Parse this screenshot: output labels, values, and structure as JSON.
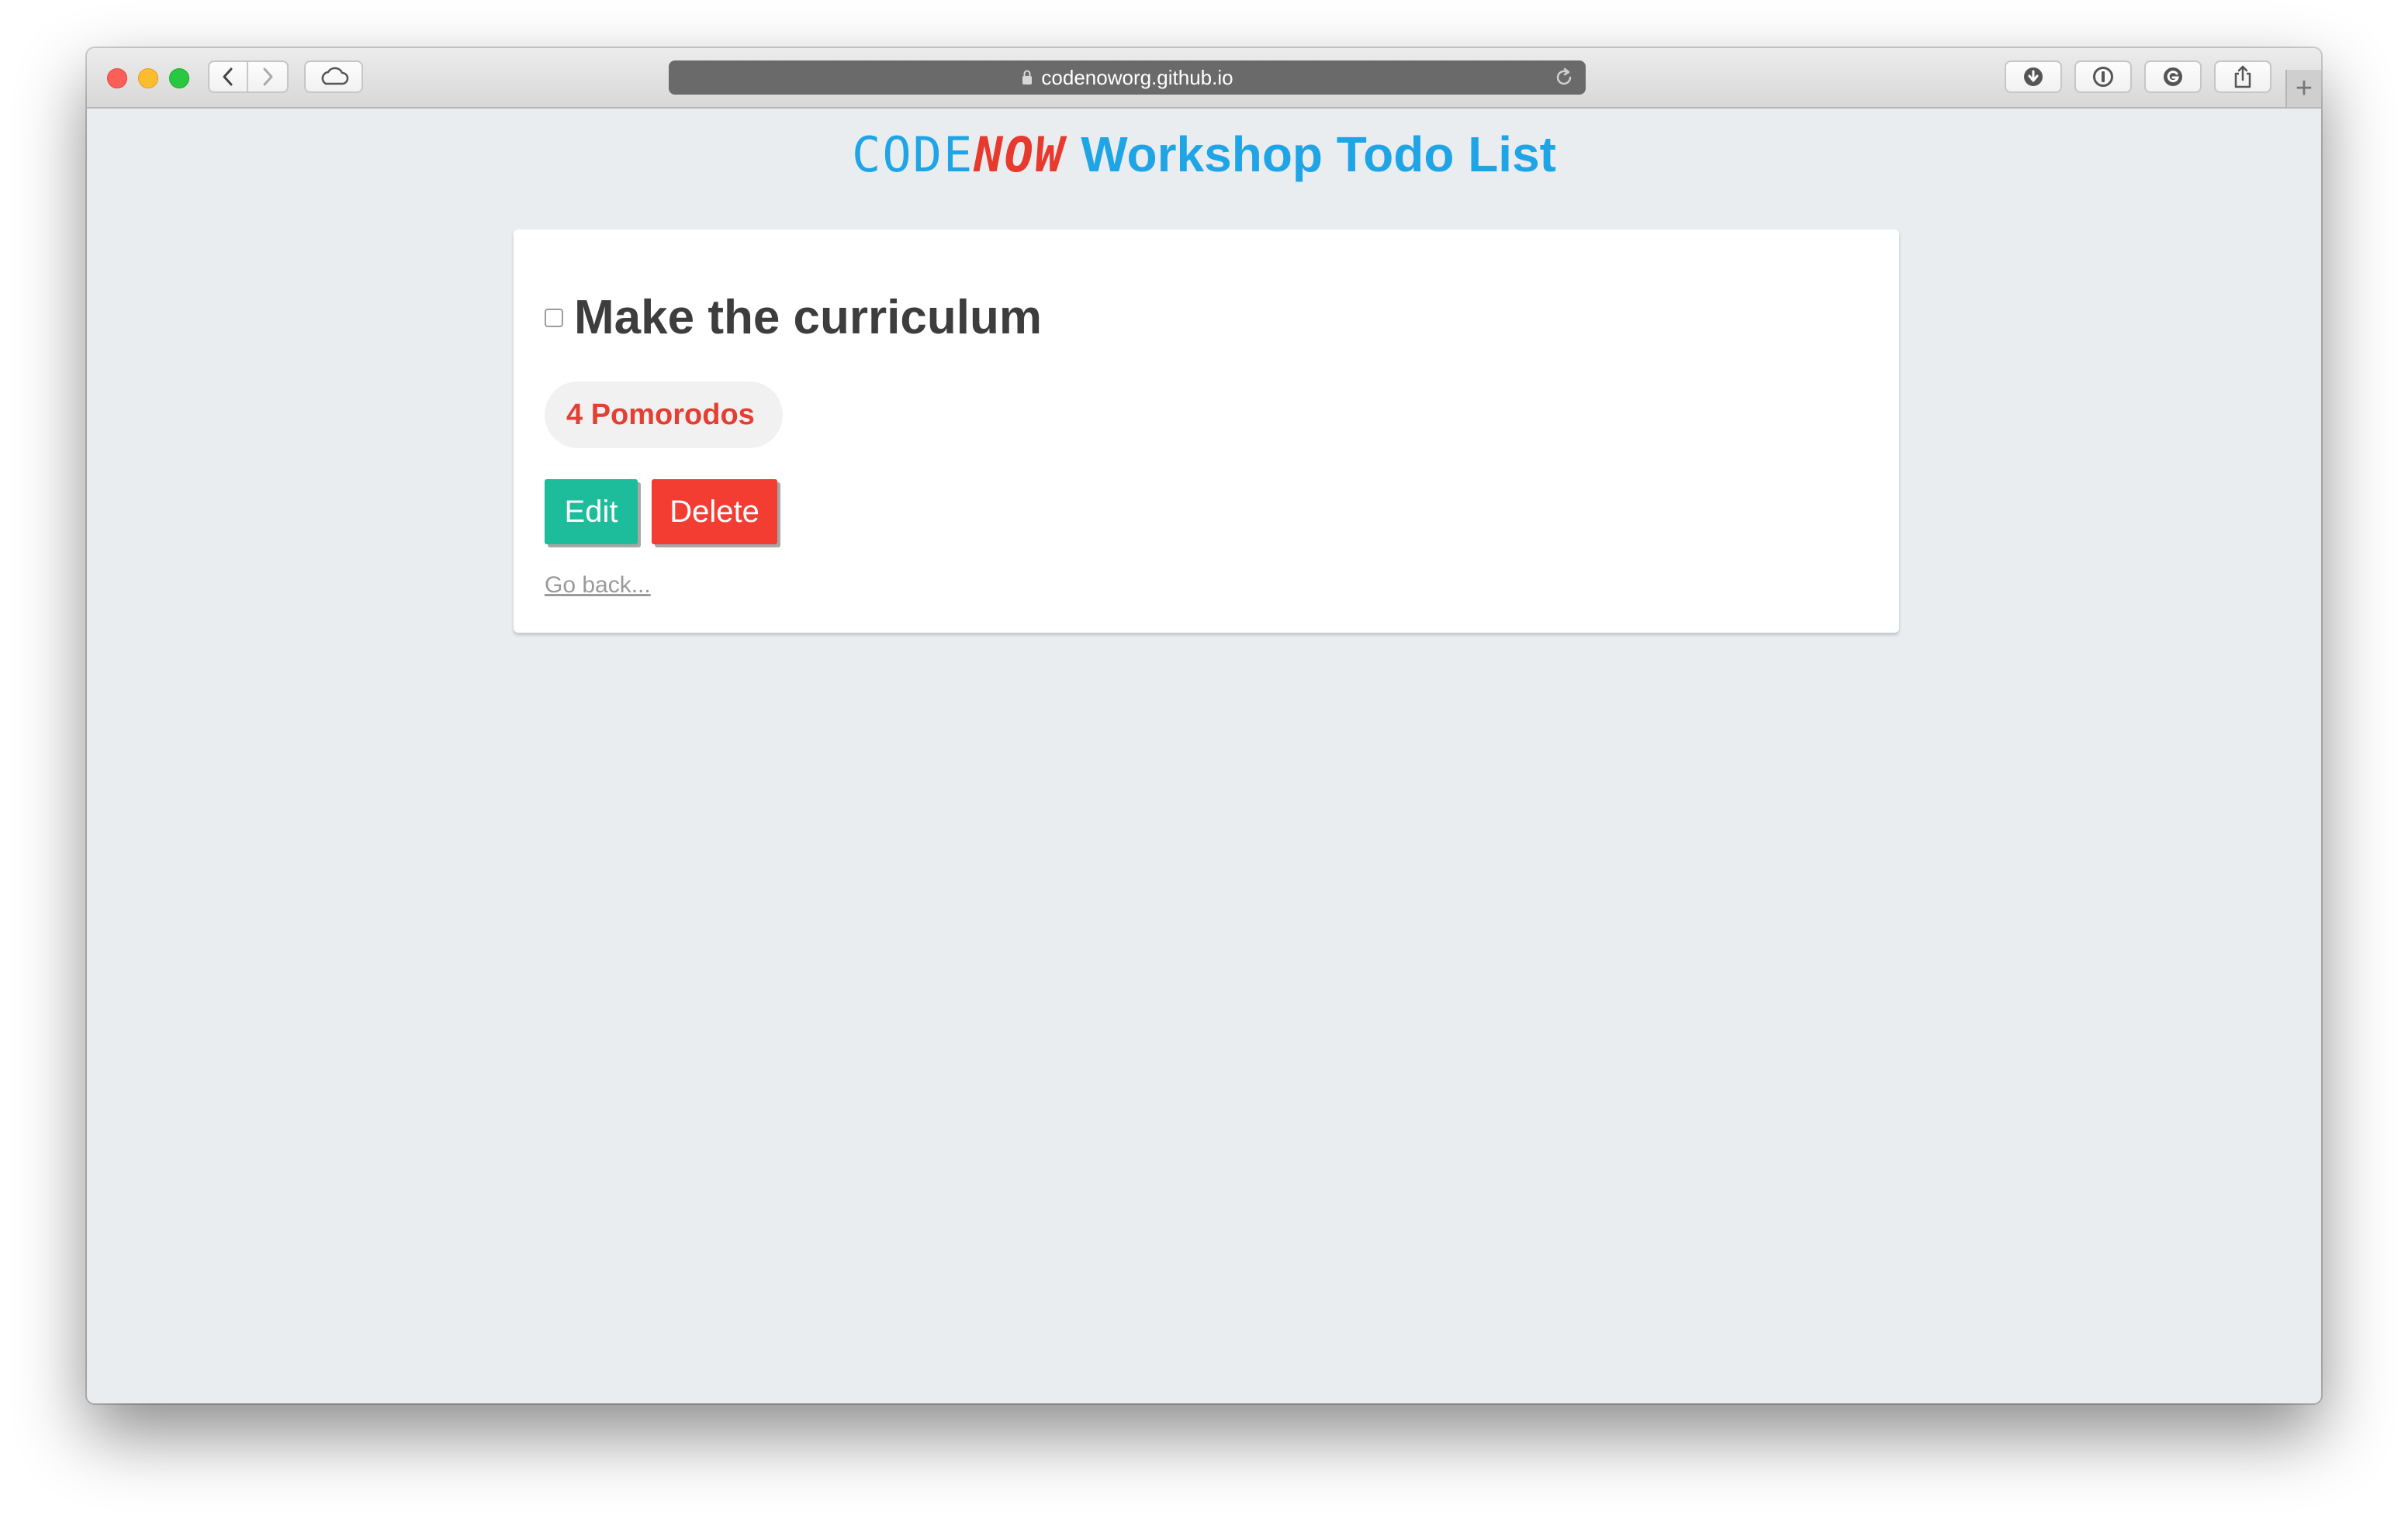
{
  "browser": {
    "url": "codenoworg.github.io",
    "new_tab_label": "+"
  },
  "header": {
    "logo_code": "CODE",
    "logo_now": "NOW",
    "title": "Workshop Todo List"
  },
  "todo": {
    "title": "Make the curriculum",
    "completed": false,
    "pomodoros": "4 Pomorodos",
    "edit_label": "Edit",
    "delete_label": "Delete",
    "back_link": "Go back..."
  },
  "colors": {
    "accent_blue": "#1fa5e6",
    "logo_red": "#e8392e",
    "edit_green": "#1dbc9b",
    "delete_red": "#f33d33",
    "pomodoro_red": "#e33f33",
    "page_bg": "#eaedf0"
  }
}
